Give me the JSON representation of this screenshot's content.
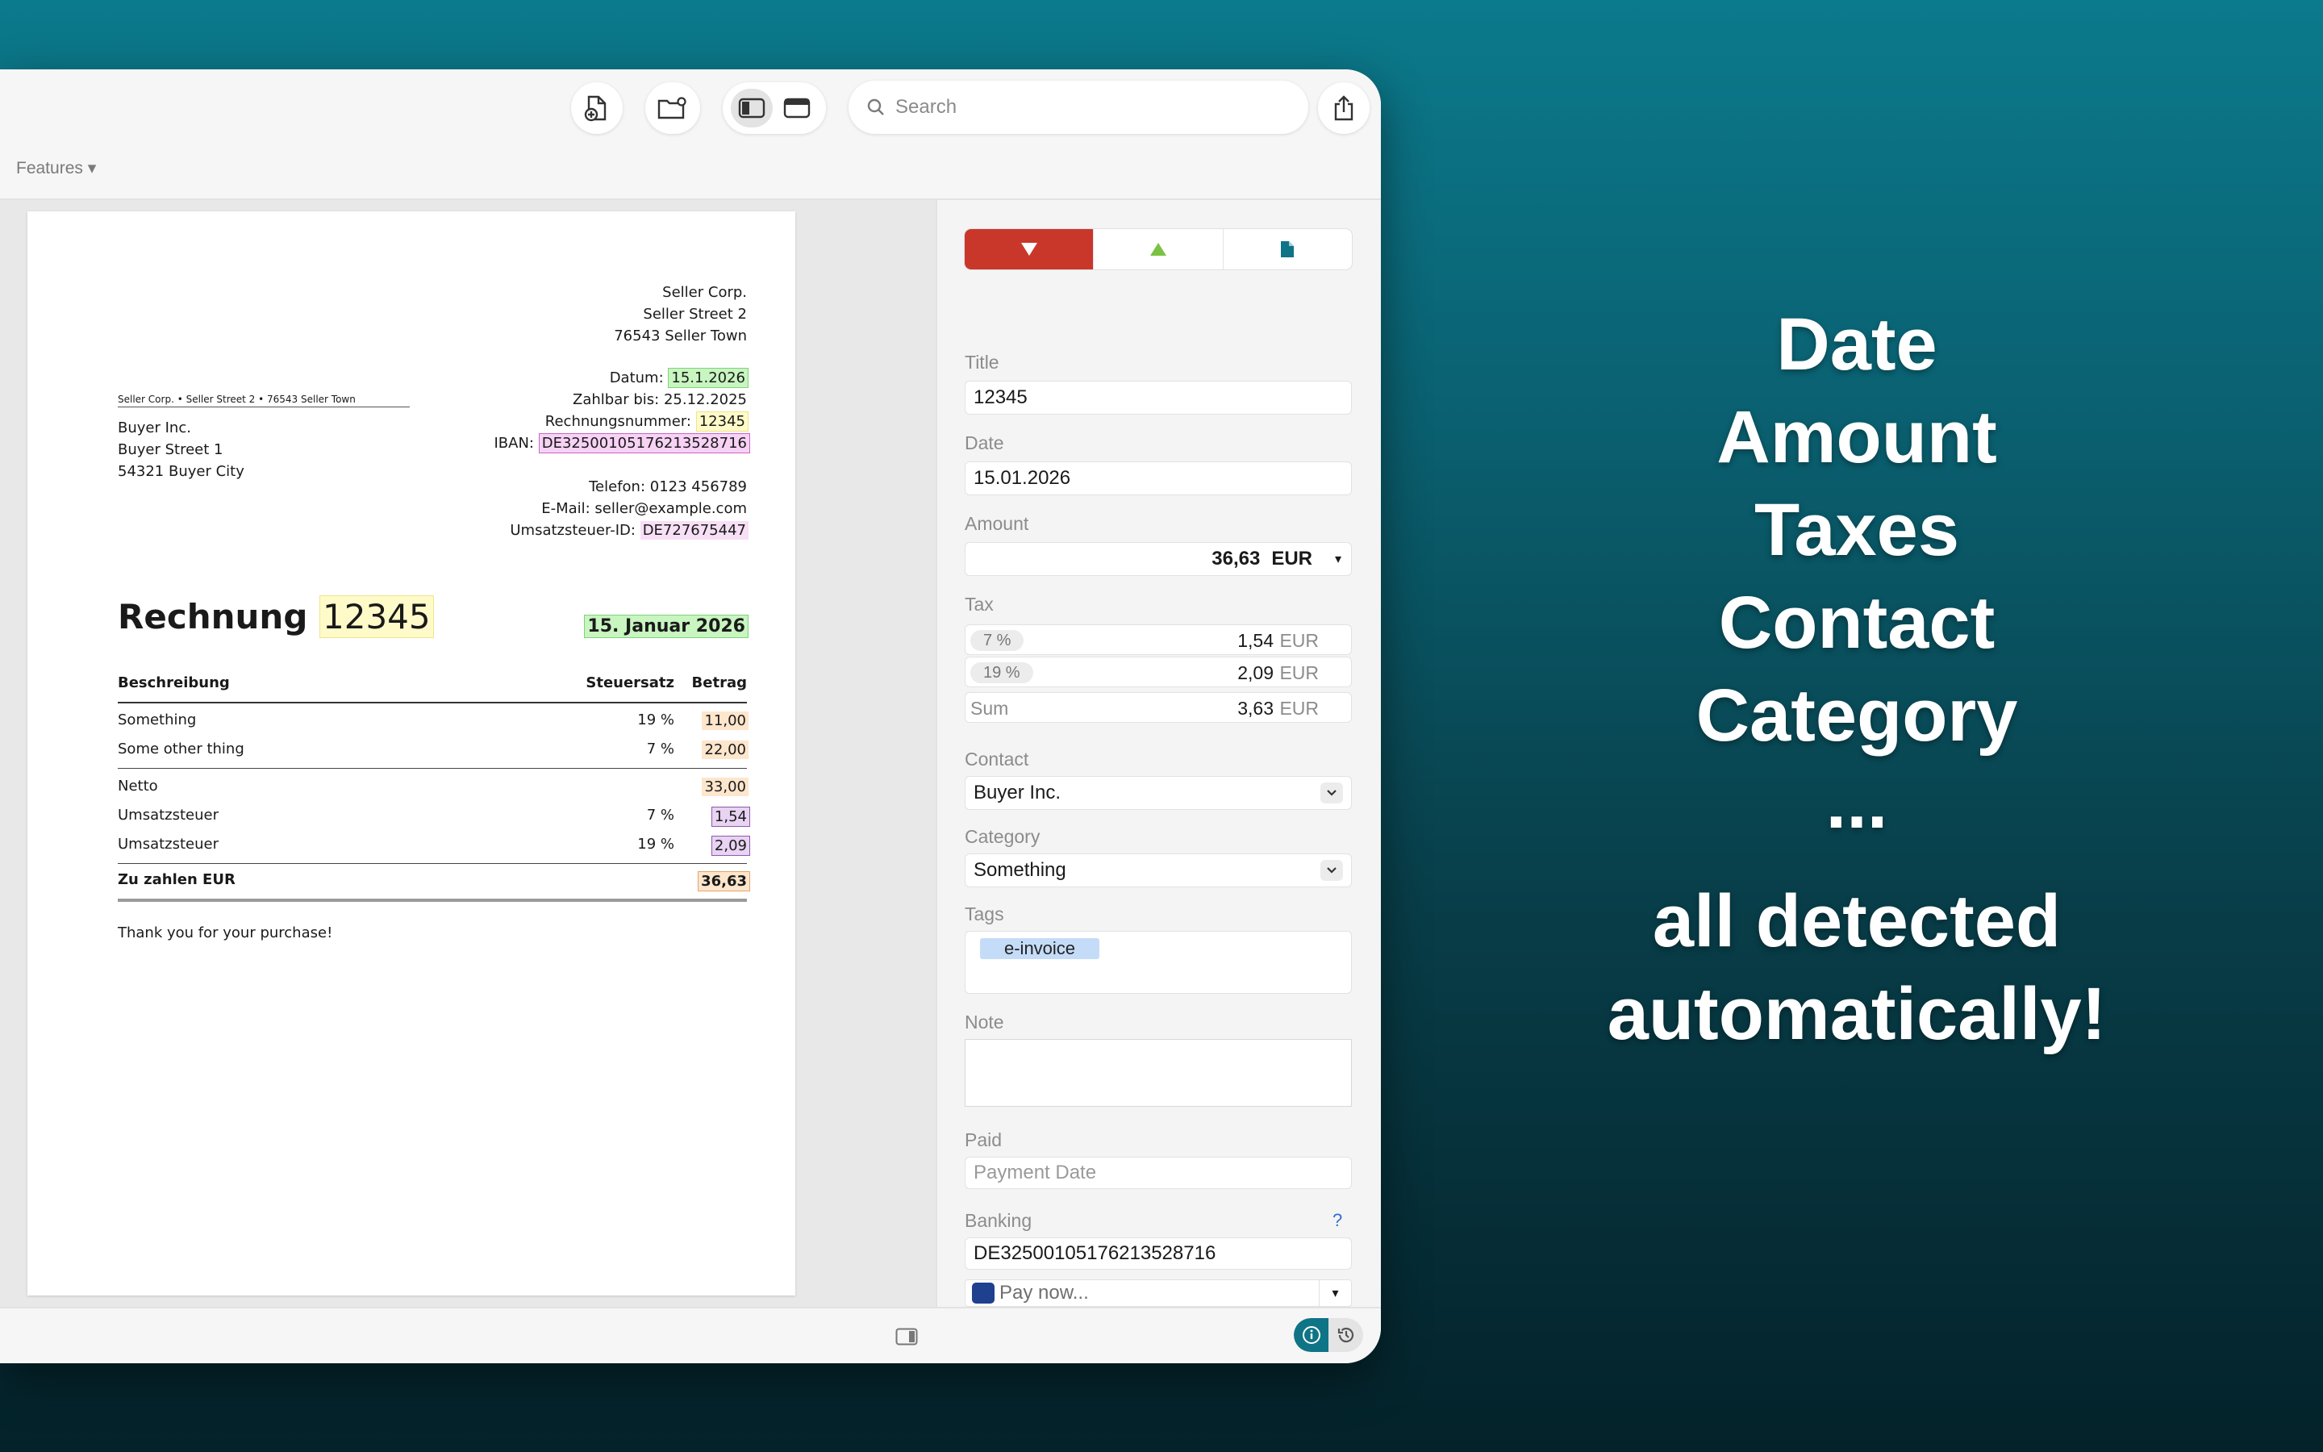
{
  "toolbar": {
    "search_placeholder": "Search",
    "features_label": "Features ▾"
  },
  "invoice": {
    "seller_name": "Seller Corp.",
    "seller_street": "Seller Street 2",
    "seller_town": "76543 Seller Town",
    "sender_line": "Seller Corp. • Seller Street 2 • 76543 Seller Town",
    "buyer_name": "Buyer Inc.",
    "buyer_street": "Buyer Street 1",
    "buyer_city": "54321 Buyer City",
    "datum_label": "Datum:",
    "datum_value": "15.1.2026",
    "zahlbar": "Zahlbar bis: 25.12.2025",
    "rechnungsnr_label": "Rechnungsnummer:",
    "rechnungsnr_value": "12345",
    "iban_label": "IBAN:",
    "iban_value": "DE32500105176213528716",
    "telefon": "Telefon: 0123 456789",
    "email": "E-Mail: seller@example.com",
    "ust_label": "Umsatzsteuer-ID:",
    "ust_value": "DE727675447",
    "heading_word": "Rechnung",
    "heading_number": "12345",
    "heading_date": "15. Januar 2026",
    "col_desc": "Beschreibung",
    "col_tax": "Steuersatz",
    "col_amount": "Betrag",
    "rows": [
      {
        "desc": "Something",
        "tax": "19 %",
        "amount": "11,00"
      },
      {
        "desc": "Some other thing",
        "tax": "7 %",
        "amount": "22,00"
      }
    ],
    "netto_label": "Netto",
    "netto_value": "33,00",
    "ust_rows": [
      {
        "desc": "Umsatzsteuer",
        "tax": "7 %",
        "amount": "1,54"
      },
      {
        "desc": "Umsatzsteuer",
        "tax": "19 %",
        "amount": "2,09"
      }
    ],
    "total_label": "Zu zahlen EUR",
    "total_value": "36,63",
    "thanks": "Thank you for your purchase!"
  },
  "inspector": {
    "title_label": "Title",
    "title_value": "12345",
    "date_label": "Date",
    "date_value": "15.01.2026",
    "amount_label": "Amount",
    "amount_value": "36,63",
    "amount_currency": "EUR",
    "tax_label": "Tax",
    "tax_rows": [
      {
        "rate": "7 %",
        "value": "1,54",
        "currency": "EUR"
      },
      {
        "rate": "19 %",
        "value": "2,09",
        "currency": "EUR"
      }
    ],
    "tax_sum_label": "Sum",
    "tax_sum_value": "3,63",
    "tax_sum_currency": "EUR",
    "contact_label": "Contact",
    "contact_value": "Buyer Inc.",
    "category_label": "Category",
    "category_value": "Something",
    "tags_label": "Tags",
    "tag": "e-invoice",
    "note_label": "Note",
    "paid_label": "Paid",
    "paid_placeholder": "Payment Date",
    "banking_label": "Banking",
    "banking_help": "?",
    "iban_value": "DE32500105176213528716",
    "pay_now": "Pay now..."
  },
  "promo": {
    "lines": [
      "Date",
      "Amount",
      "Taxes",
      "Contact",
      "Category",
      "..."
    ],
    "tagline_1": "all detected",
    "tagline_2": "automatically!"
  },
  "colors": {
    "accent_red": "#c9372b",
    "accent_teal": "#0f7486",
    "up_green": "#7cc242"
  }
}
